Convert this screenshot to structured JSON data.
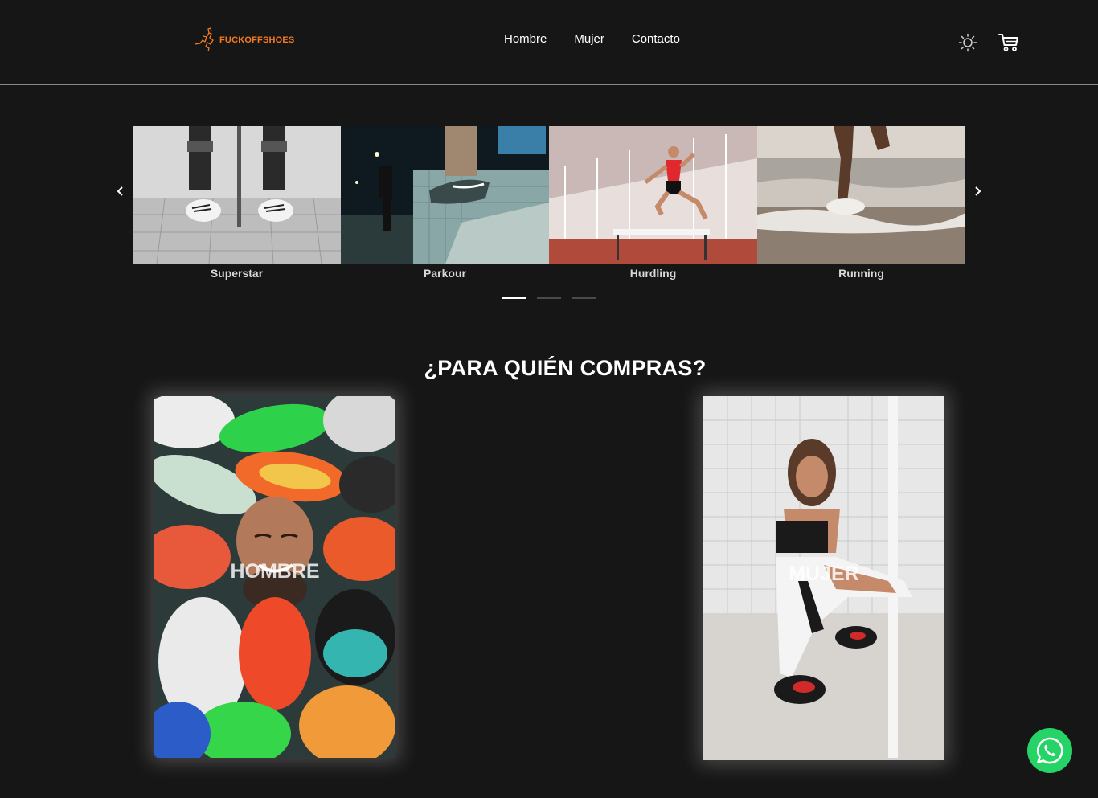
{
  "header": {
    "logo_text": "FUCKOFFSHOES",
    "logo_color": "#f47b20",
    "nav": [
      {
        "label": "Hombre"
      },
      {
        "label": "Mujer"
      },
      {
        "label": "Contacto"
      }
    ],
    "icons": [
      "sun-icon",
      "cart-icon"
    ]
  },
  "carousel": {
    "prev_icon": "chevron-left-icon",
    "next_icon": "chevron-right-icon",
    "slides": [
      {
        "caption": "Superstar"
      },
      {
        "caption": "Parkour"
      },
      {
        "caption": "Hurdling"
      },
      {
        "caption": "Running"
      }
    ],
    "pages": 3,
    "active_page": 1
  },
  "section": {
    "title": "¿PARA QUIÉN COMPRAS?"
  },
  "categories": [
    {
      "label": "HOMBRE"
    },
    {
      "label": "MUJER"
    }
  ],
  "whatsapp": {
    "icon": "whatsapp-icon",
    "color": "#25d366"
  }
}
